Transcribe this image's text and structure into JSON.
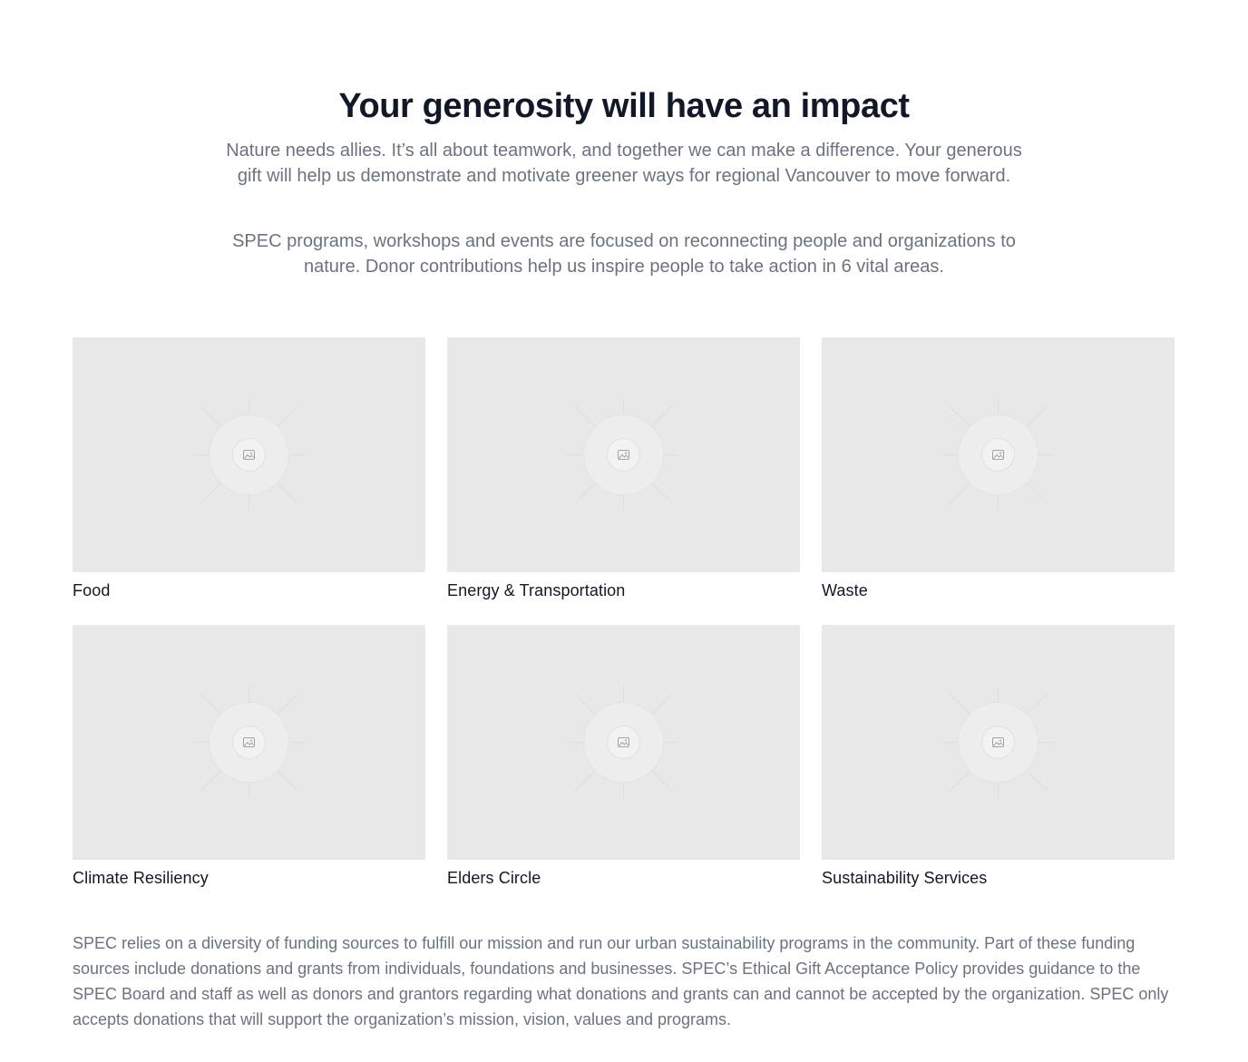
{
  "heading": "Your generosity will have an impact",
  "intro": [
    "Nature needs allies. It’s all about teamwork, and together we can make a difference. Your generous gift will help us demonstrate and motivate greener ways for regional Vancouver to move forward.",
    "SPEC programs, workshops and events are focused on reconnecting people and organizations to nature. Donor contributions help us inspire people to take action in 6 vital areas."
  ],
  "areas": [
    {
      "label": "Food",
      "icon": "image-placeholder-icon"
    },
    {
      "label": "Energy & Transportation",
      "icon": "image-placeholder-icon"
    },
    {
      "label": "Waste",
      "icon": "image-placeholder-icon"
    },
    {
      "label": "Climate Resiliency",
      "icon": "image-placeholder-icon"
    },
    {
      "label": "Elders Circle",
      "icon": "image-placeholder-icon"
    },
    {
      "label": "Sustainability Services",
      "icon": "image-placeholder-icon"
    }
  ],
  "footer": "SPEC relies on a diversity of funding sources to fulfill our mission and run our urban sustainability programs in the community. Part of these funding sources include donations and grants from individuals, foundations and businesses. SPEC’s Ethical Gift Acceptance Policy provides guidance to the SPEC Board and staff as well as donors and grantors regarding what donations and grants can and cannot be accepted by the organization. SPEC only accepts donations that will support the organization’s mission, vision, values and programs.",
  "colors": {
    "heading": "#111827",
    "body_text": "#6b7280",
    "placeholder_bg": "#e8e8e8"
  }
}
